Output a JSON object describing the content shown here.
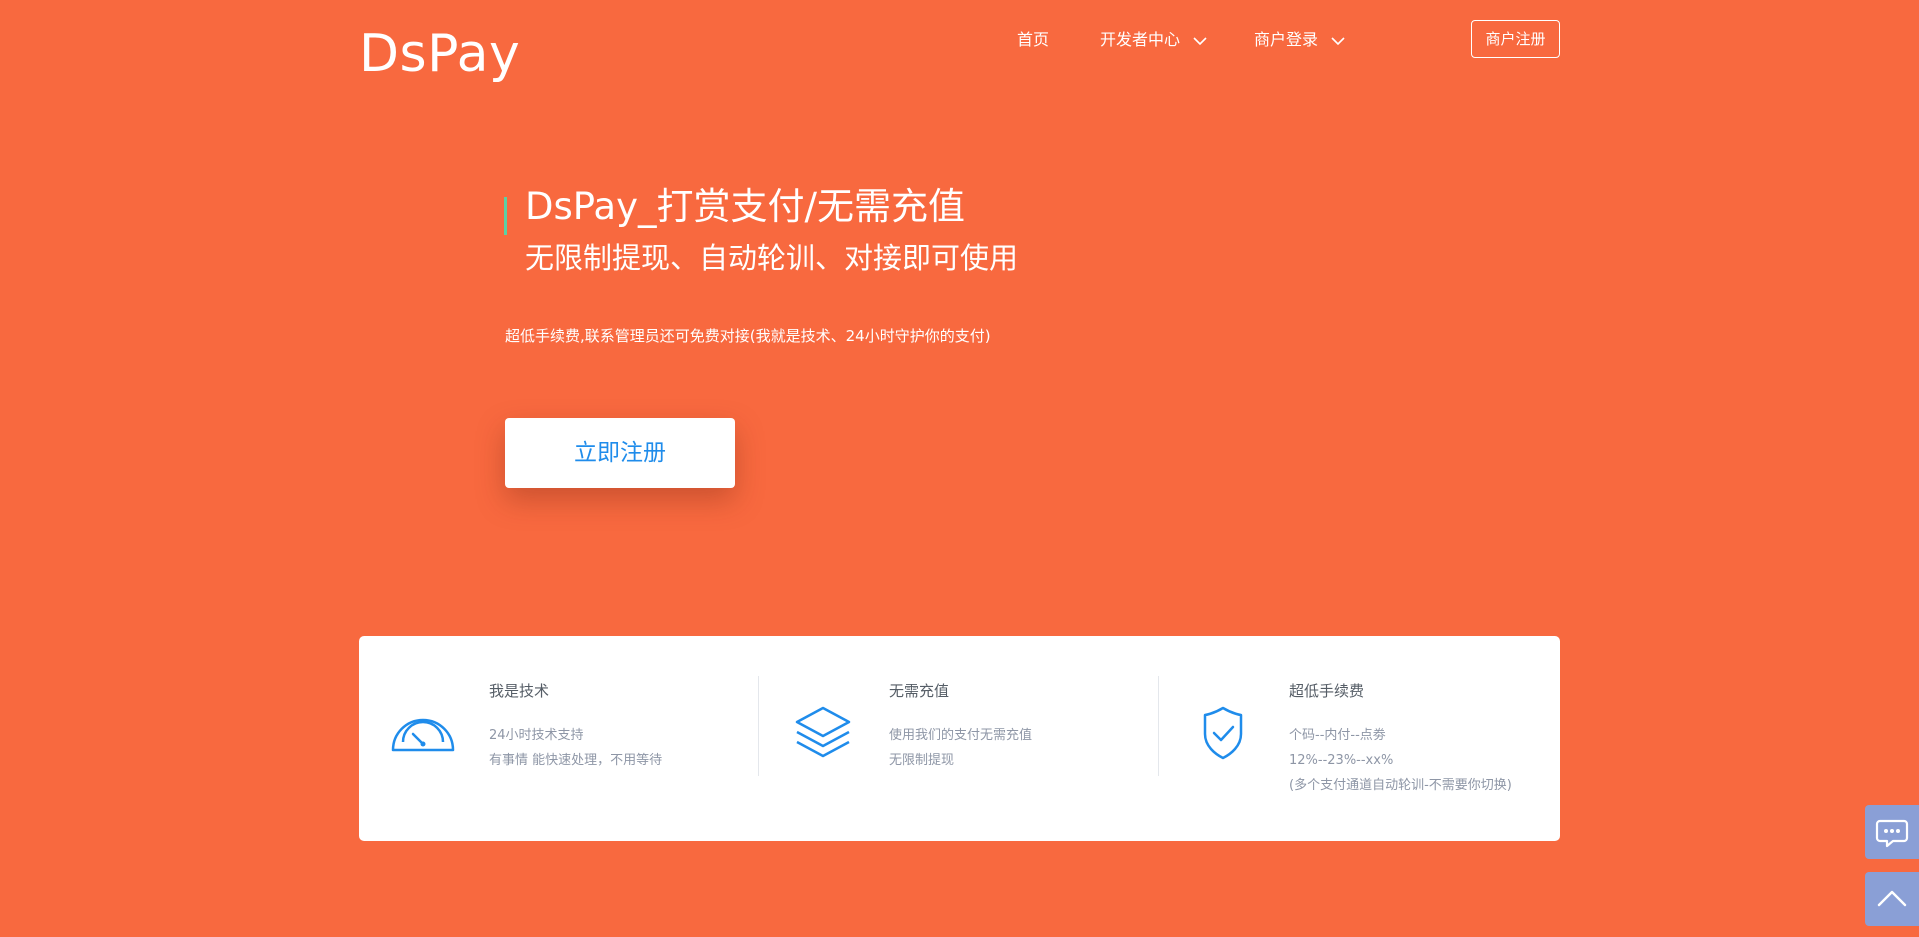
{
  "brand": {
    "logo_text": "DsPay"
  },
  "nav": {
    "home": "首页",
    "developer": "开发者中心",
    "merchant_login": "商户登录",
    "register_button": "商户注册"
  },
  "hero": {
    "title": "DsPay_打赏支付/无需充值",
    "subtitle": "无限制提现、自动轮训、对接即可使用",
    "description": "超低手续费,联系管理员还可免费对接(我就是技术、24小时守护你的支付)",
    "cta": "立即注册"
  },
  "features": [
    {
      "title": "我是技术",
      "icon": "speedometer-icon",
      "lines": [
        "24小时技术支持",
        "有事情 能快速处理，不用等待"
      ]
    },
    {
      "title": "无需充值",
      "icon": "layers-icon",
      "lines": [
        "使用我们的支付无需充值",
        "无限制提现"
      ]
    },
    {
      "title": "超低手续费",
      "icon": "shield-check-icon",
      "lines": [
        "个码--内付--点劵",
        "12%--23%--xx%",
        "(多个支付通道自动轮训-不需要你切换)"
      ]
    }
  ],
  "colors": {
    "background": "#f8693f",
    "accent_blue": "#1f8ceb",
    "hero_bar": "#5bd1a3",
    "float_button": "#8a9fd6"
  }
}
